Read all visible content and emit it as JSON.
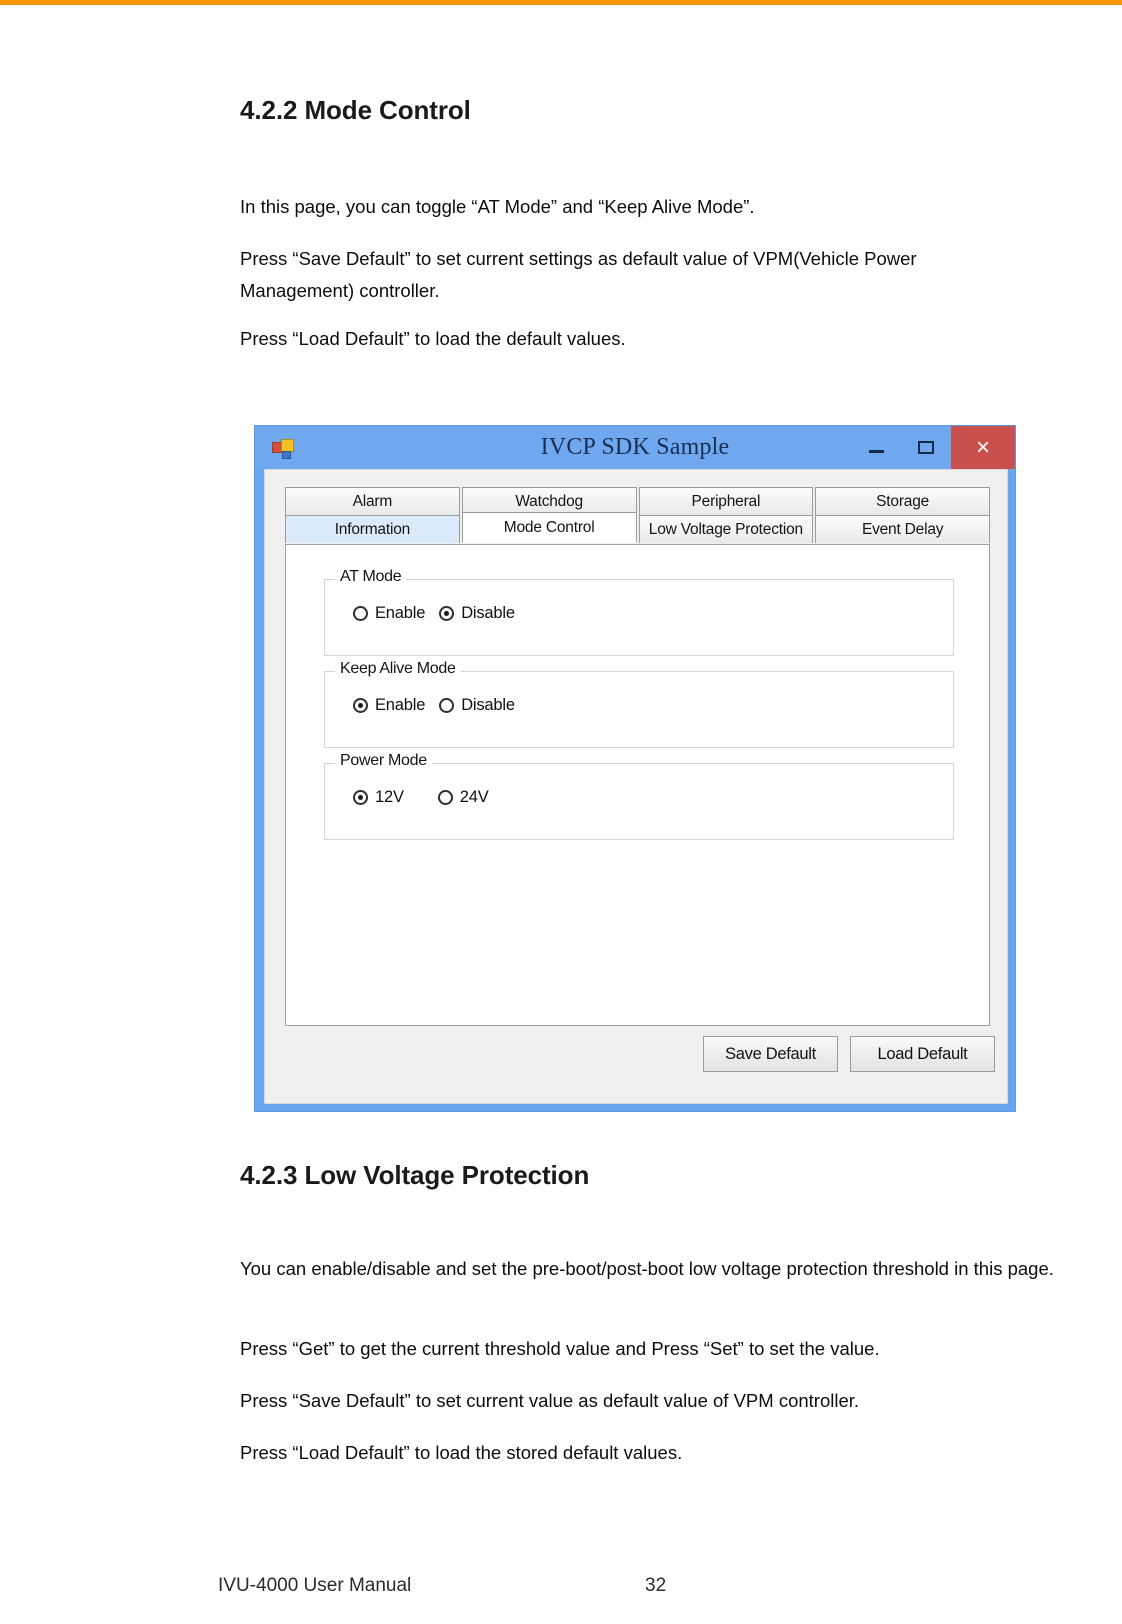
{
  "page": {
    "top_rule_color": "#F59405",
    "footer_left": "IVU-4000 User Manual",
    "footer_page": "32"
  },
  "sections": [
    {
      "heading": "4.2.2 Mode Control",
      "paragraphs": [
        "In this page, you can toggle “AT Mode” and “Keep Alive Mode”.",
        "Press “Save Default” to set current settings as default value of VPM(Vehicle Power Management) controller.",
        "Press “Load Default” to load the default values."
      ]
    },
    {
      "heading": "4.2.3 Low Voltage Protection",
      "paragraphs": [
        "You can enable/disable and set the pre-boot/post-boot low voltage protection threshold in this page.",
        "Press “Get” to get the current threshold value and Press “Set” to set the value.",
        "Press “Save Default” to set current value as default value of VPM controller.",
        "Press “Load Default” to load the stored default values."
      ]
    }
  ],
  "app_window": {
    "title": "IVCP SDK Sample",
    "title_bar_color": "#6FA8EF",
    "close_button_color": "#C9504C",
    "icon_name": "application-icon",
    "window_controls": {
      "minimize": "–",
      "maximize": "□",
      "close": "×"
    },
    "tabs": {
      "row1": [
        {
          "label": "Alarm",
          "state": "normal"
        },
        {
          "label": "Watchdog",
          "state": "normal"
        },
        {
          "label": "Peripheral",
          "state": "normal"
        },
        {
          "label": "Storage",
          "state": "normal"
        }
      ],
      "row2": [
        {
          "label": "Information",
          "state": "highlight"
        },
        {
          "label": "Mode Control",
          "state": "selected"
        },
        {
          "label": "Low Voltage Protection",
          "state": "normal"
        },
        {
          "label": "Event Delay",
          "state": "normal"
        }
      ]
    },
    "groups": [
      {
        "title": "AT Mode",
        "options": [
          {
            "label": "Enable",
            "checked": false
          },
          {
            "label": "Disable",
            "checked": true
          }
        ]
      },
      {
        "title": "Keep Alive Mode",
        "options": [
          {
            "label": "Enable",
            "checked": true
          },
          {
            "label": "Disable",
            "checked": false
          }
        ]
      },
      {
        "title": "Power Mode",
        "options": [
          {
            "label": "12V",
            "checked": true
          },
          {
            "label": "24V",
            "checked": false
          }
        ]
      }
    ],
    "buttons": {
      "save_default": "Save Default",
      "load_default": "Load Default"
    }
  }
}
